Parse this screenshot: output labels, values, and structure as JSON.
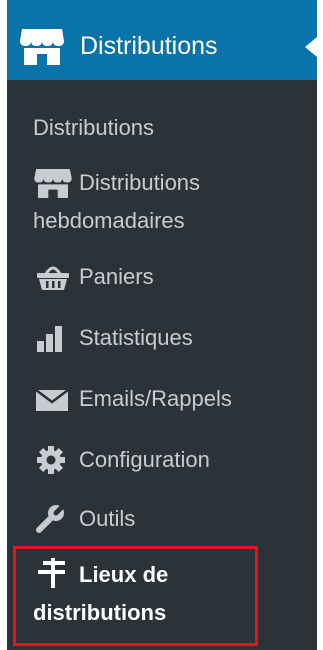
{
  "menu": {
    "title": "Distributions",
    "icon": "store-icon",
    "accent_color": "#0a73aa",
    "background_color": "#2c3338",
    "items": [
      {
        "label": "Distributions",
        "icon": ""
      },
      {
        "label_line1": "Distributions",
        "label_line2": "hebdomadaires",
        "icon": "store-icon"
      },
      {
        "label": "Paniers",
        "icon": "basket-icon"
      },
      {
        "label": "Statistiques",
        "icon": "bar-chart-icon"
      },
      {
        "label": "Emails/Rappels",
        "icon": "envelope-icon"
      },
      {
        "label": "Configuration",
        "icon": "gear-icon"
      },
      {
        "label": "Outils",
        "icon": "wrench-icon"
      },
      {
        "label_line1": "Lieux de",
        "label_line2": "distributions",
        "icon": "signpost-icon",
        "current": true
      }
    ],
    "highlight_color": "#e3161d"
  }
}
